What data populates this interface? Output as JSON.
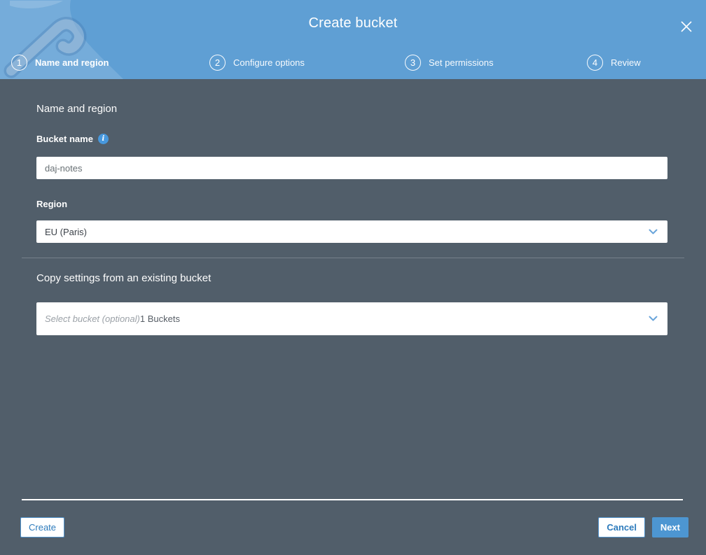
{
  "modal": {
    "title": "Create bucket"
  },
  "steps": [
    {
      "number": "1",
      "label": "Name and region",
      "active": true
    },
    {
      "number": "2",
      "label": "Configure options",
      "active": false
    },
    {
      "number": "3",
      "label": "Set permissions",
      "active": false
    },
    {
      "number": "4",
      "label": "Review",
      "active": false
    }
  ],
  "form": {
    "section_heading": "Name and region",
    "bucket_name_label": "Bucket name",
    "bucket_name_value": "daj-notes",
    "info_glyph": "i",
    "region_label": "Region",
    "region_value": "EU (Paris)",
    "copy_heading": "Copy settings from an existing bucket",
    "copy_placeholder": "Select bucket (optional)",
    "copy_suffix": "1 Buckets"
  },
  "footer": {
    "create": "Create",
    "cancel": "Cancel",
    "next": "Next"
  },
  "icons": {
    "close": "x-close",
    "info": "info-circle",
    "chevron": "chevron-down"
  },
  "colors": {
    "header_blue": "#5f9fd4",
    "body_slate": "#515e6a",
    "primary_button_blue": "#4d96d2",
    "button_text_blue": "#2d7bbc",
    "info_icon_blue": "#4798dd",
    "chevron_blue": "#6aa5da"
  }
}
